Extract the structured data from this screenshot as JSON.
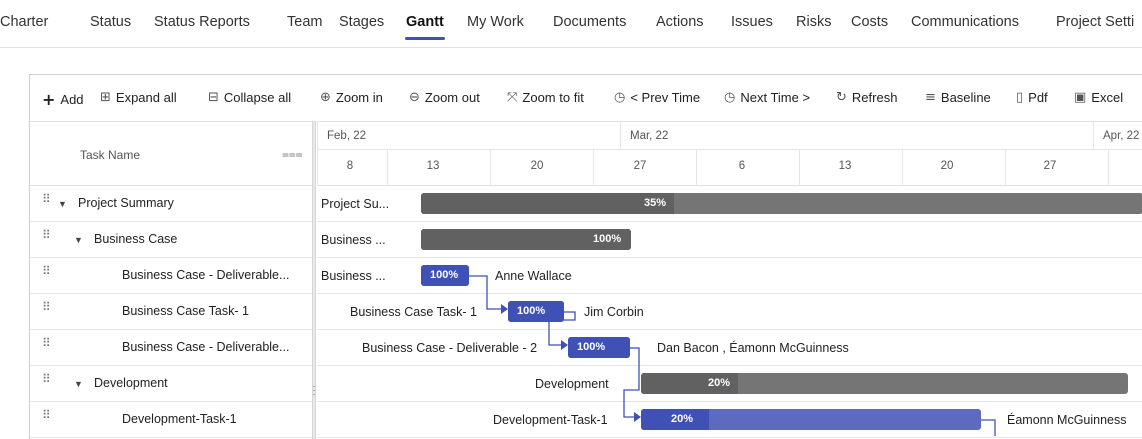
{
  "tabs": [
    "Charter",
    "Status",
    "Status Reports",
    "Team",
    "Stages",
    "Gantt",
    "My Work",
    "Documents",
    "Actions",
    "Issues",
    "Risks",
    "Costs",
    "Communications",
    "Project Setti"
  ],
  "active_tab": "Gantt",
  "toolbar": {
    "add": "Add",
    "expand_all": "Expand all",
    "collapse_all": "Collapse all",
    "zoom_in": "Zoom in",
    "zoom_out": "Zoom out",
    "zoom_fit": "Zoom to fit",
    "prev_time": "< Prev Time",
    "next_time": "Next Time >",
    "refresh": "Refresh",
    "baseline": "Baseline",
    "pdf": "Pdf",
    "excel": "Excel"
  },
  "grid": {
    "column_header": "Task Name",
    "rows": [
      {
        "name": "Project Summary",
        "level": 0,
        "expandable": true
      },
      {
        "name": "Business Case",
        "level": 1,
        "expandable": true
      },
      {
        "name": "Business Case - Deliverable...",
        "level": 2,
        "expandable": false
      },
      {
        "name": "Business Case Task- 1",
        "level": 2,
        "expandable": false
      },
      {
        "name": "Business Case - Deliverable...",
        "level": 2,
        "expandable": false
      },
      {
        "name": "Development",
        "level": 1,
        "expandable": true
      },
      {
        "name": "Development-Task-1",
        "level": 2,
        "expandable": false
      }
    ]
  },
  "timeline": {
    "months": [
      "Feb, 22",
      "Mar, 22",
      "Apr, 22"
    ],
    "weeks": [
      "8",
      "13",
      "20",
      "27",
      "6",
      "13",
      "20",
      "27"
    ]
  },
  "bars": [
    {
      "row": 0,
      "label_left": "Project Su...",
      "percent": "35%",
      "progress": 0.35,
      "type": "summary",
      "resource": ""
    },
    {
      "row": 1,
      "label_left": "Business ...",
      "percent": "100%",
      "progress": 1.0,
      "type": "summary",
      "resource": ""
    },
    {
      "row": 2,
      "label_left": "Business ...",
      "percent": "100%",
      "progress": 1.0,
      "type": "task",
      "resource": "Anne Wallace"
    },
    {
      "row": 3,
      "label_left": "Business Case Task- 1",
      "percent": "100%",
      "progress": 1.0,
      "type": "task",
      "resource": "Jim Corbin"
    },
    {
      "row": 4,
      "label_left": "Business Case - Deliverable - 2",
      "percent": "100%",
      "progress": 1.0,
      "type": "task",
      "resource": "Dan Bacon , Éamonn McGuinness"
    },
    {
      "row": 5,
      "label_left": "Development",
      "percent": "20%",
      "progress": 0.2,
      "type": "summary",
      "resource": ""
    },
    {
      "row": 6,
      "label_left": "Development-Task-1",
      "percent": "20%",
      "progress": 0.2,
      "type": "task",
      "resource": "Éamonn McGuinness"
    }
  ],
  "colors": {
    "accent": "#3f51b5",
    "task_bar": "#5c6bc0",
    "summary_bar": "#757575",
    "summary_progress": "#616161"
  }
}
